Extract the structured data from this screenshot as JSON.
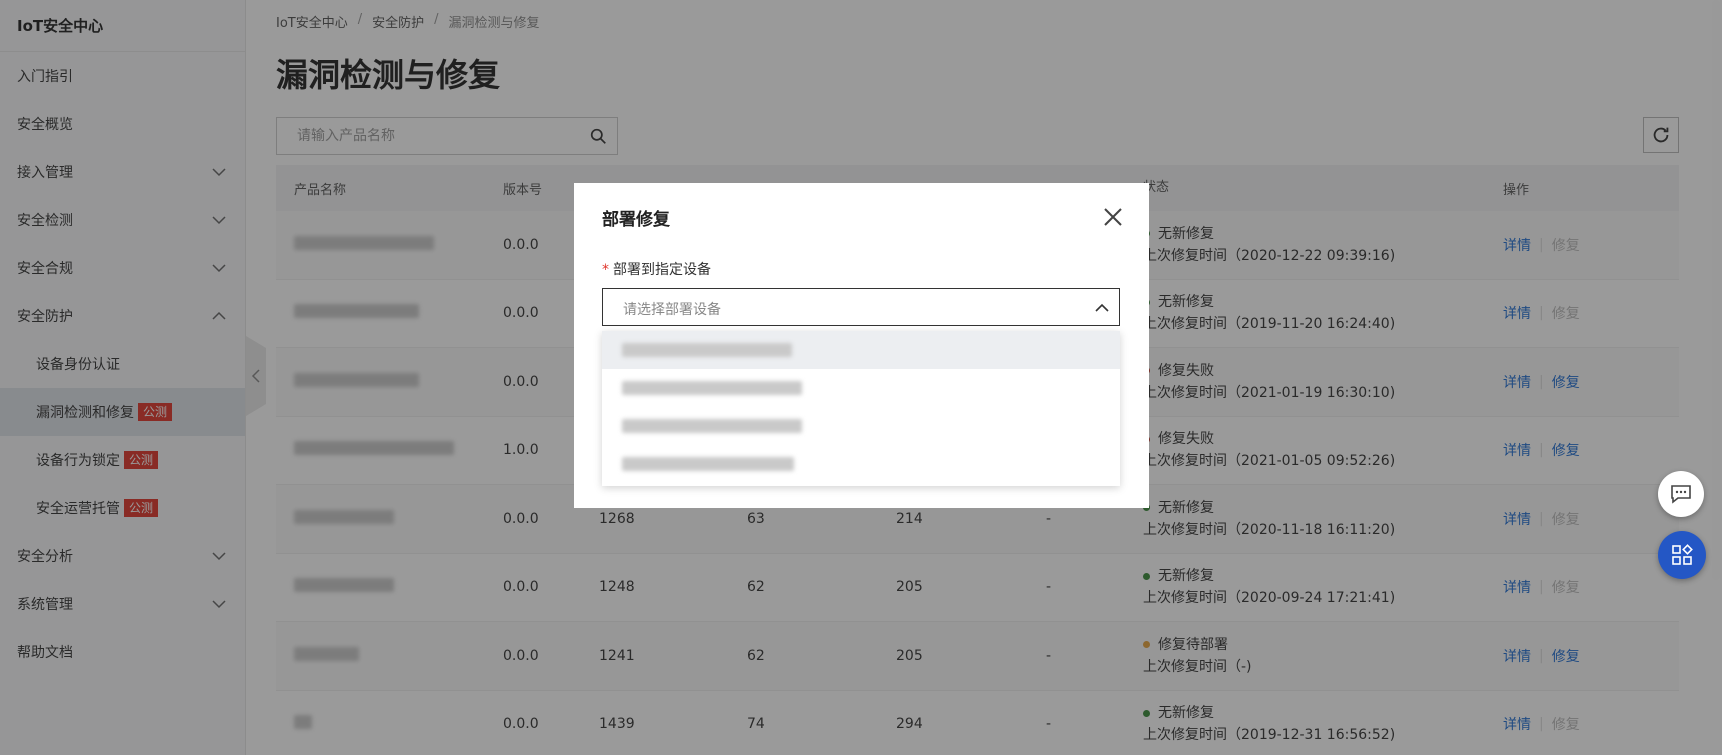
{
  "sidebar": {
    "title": "IoT安全中心",
    "items": [
      {
        "label": "入门指引",
        "chevron": ""
      },
      {
        "label": "安全概览",
        "chevron": ""
      },
      {
        "label": "接入管理",
        "chevron": "down"
      },
      {
        "label": "安全检测",
        "chevron": "down"
      },
      {
        "label": "安全合规",
        "chevron": "down"
      },
      {
        "label": "安全防护",
        "chevron": "up"
      },
      {
        "label": "设备身份认证",
        "sub": true
      },
      {
        "label": "漏洞检测和修复",
        "sub": true,
        "badge": "公测",
        "active": true
      },
      {
        "label": "设备行为锁定",
        "sub": true,
        "badge": "公测"
      },
      {
        "label": "安全运营托管",
        "sub": true,
        "badge": "公测"
      },
      {
        "label": "安全分析",
        "chevron": "down"
      },
      {
        "label": "系统管理",
        "chevron": "down"
      },
      {
        "label": "帮助文档",
        "chevron": ""
      }
    ]
  },
  "breadcrumb": [
    "IoT安全中心",
    "安全防护",
    "漏洞检测与修复"
  ],
  "page_title": "漏洞检测与修复",
  "search": {
    "placeholder": "请输入产品名称"
  },
  "table": {
    "headers": [
      "产品名称",
      "版本号",
      "",
      "",
      "",
      "",
      "状态",
      "操作"
    ],
    "rows": [
      {
        "version": "0.0.0",
        "c3": "",
        "c4": "",
        "c5": "",
        "c6": "",
        "status": "无新修复",
        "status_color": "#3a8a3a",
        "time": "上次修复时间（2020-12-22 09:39:16)",
        "detail": "详情",
        "fix": "修复",
        "fix_enabled": false
      },
      {
        "version": "0.0.0",
        "c3": "",
        "c4": "",
        "c5": "",
        "c6": "",
        "status": "无新修复",
        "status_color": "#3a8a3a",
        "time": "上次修复时间（2019-11-20 16:24:40)",
        "detail": "详情",
        "fix": "修复",
        "fix_enabled": false
      },
      {
        "version": "0.0.0",
        "c3": "",
        "c4": "",
        "c5": "",
        "c6": "",
        "status": "修复失败",
        "status_color": "#c0392b",
        "time": "上次修复时间（2021-01-19 16:30:10)",
        "detail": "详情",
        "fix": "修复",
        "fix_enabled": true
      },
      {
        "version": "1.0.0",
        "c3": "",
        "c4": "",
        "c5": "",
        "c6": "",
        "status": "修复失败",
        "status_color": "#c0392b",
        "time": "上次修复时间（2021-01-05 09:52:26)",
        "detail": "详情",
        "fix": "修复",
        "fix_enabled": true
      },
      {
        "version": "0.0.0",
        "c3": "1268",
        "c4": "63",
        "c5": "214",
        "c6": "-",
        "status": "无新修复",
        "status_color": "#3a8a3a",
        "time": "上次修复时间（2020-11-18 16:11:20)",
        "detail": "详情",
        "fix": "修复",
        "fix_enabled": false
      },
      {
        "version": "0.0.0",
        "c3": "1248",
        "c4": "62",
        "c5": "205",
        "c6": "-",
        "status": "无新修复",
        "status_color": "#3a8a3a",
        "time": "上次修复时间（2020-09-24 17:21:41)",
        "detail": "详情",
        "fix": "修复",
        "fix_enabled": false
      },
      {
        "version": "0.0.0",
        "c3": "1241",
        "c4": "62",
        "c5": "205",
        "c6": "-",
        "status": "修复待部署",
        "status_color": "#e6a23c",
        "time": "上次修复时间（-)",
        "detail": "详情",
        "fix": "修复",
        "fix_enabled": true
      },
      {
        "version": "0.0.0",
        "c3": "1439",
        "c4": "74",
        "c5": "294",
        "c6": "-",
        "status": "无新修复",
        "status_color": "#3a8a3a",
        "time": "上次修复时间（2019-12-31 16:56:52)",
        "detail": "详情",
        "fix": "修复",
        "fix_enabled": false
      }
    ]
  },
  "modal": {
    "title": "部署修复",
    "field_required": "*",
    "field_label": "部署到指定设备",
    "select_placeholder": "请选择部署设备"
  },
  "colors": {
    "accent": "#1f6ed4",
    "badge": "#e0352b",
    "fab": "#2457c5"
  }
}
